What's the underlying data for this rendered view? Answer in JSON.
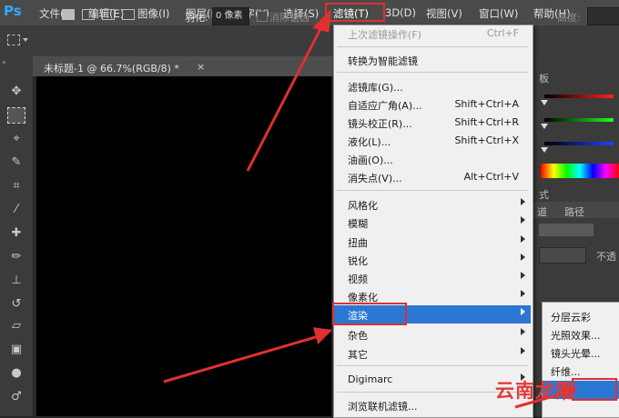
{
  "app": {
    "logo": "Ps"
  },
  "menubar": {
    "items": [
      "文件(F)",
      "编辑(E)",
      "图像(I)",
      "图层(L)",
      "文字(Y)",
      "选择(S)",
      "滤镜(T)",
      "3D(D)",
      "视图(V)",
      "窗口(W)",
      "帮助(H)"
    ],
    "active_index": 6
  },
  "options": {
    "feather_label": "羽化:",
    "feather_value": "0 像素",
    "antialias_label": "消除锯齿",
    "height_label": "高度:"
  },
  "document": {
    "tab_title": "未标题-1 @ 66.7%(RGB/8) *",
    "close": "×"
  },
  "filter_menu": {
    "items": [
      {
        "label": "上次滤镜操作(F)",
        "shortcut": "Ctrl+F",
        "disabled": true
      },
      {
        "label": "转换为智能滤镜"
      },
      {
        "label": "滤镜库(G)..."
      },
      {
        "label": "自适应广角(A)...",
        "shortcut": "Shift+Ctrl+A"
      },
      {
        "label": "镜头校正(R)...",
        "shortcut": "Shift+Ctrl+R"
      },
      {
        "label": "液化(L)...",
        "shortcut": "Shift+Ctrl+X"
      },
      {
        "label": "油画(O)..."
      },
      {
        "label": "消失点(V)...",
        "shortcut": "Alt+Ctrl+V"
      },
      {
        "label": "风格化",
        "submenu": true
      },
      {
        "label": "模糊",
        "submenu": true
      },
      {
        "label": "扭曲",
        "submenu": true
      },
      {
        "label": "锐化",
        "submenu": true
      },
      {
        "label": "视频",
        "submenu": true
      },
      {
        "label": "像素化",
        "submenu": true
      },
      {
        "label": "渲染",
        "submenu": true,
        "highlighted": true
      },
      {
        "label": "杂色",
        "submenu": true
      },
      {
        "label": "其它",
        "submenu": true
      },
      {
        "label": "Digimarc",
        "submenu": true
      },
      {
        "label": "浏览联机滤镜..."
      }
    ]
  },
  "render_submenu": {
    "items": [
      {
        "label": "分层云彩"
      },
      {
        "label": "光照效果..."
      },
      {
        "label": "镜头光晕..."
      },
      {
        "label": "纤维..."
      },
      {
        "label": "",
        "highlighted": true
      }
    ]
  },
  "right_panel": {
    "tabs_top": [
      "板"
    ],
    "tabs_mid": [
      "式"
    ],
    "tabs_layers": [
      "道",
      "路径"
    ],
    "opacity_label": "不透"
  },
  "watermark": "云南龙网",
  "colors": {
    "highlight": "#2a78d4",
    "annotation_red": "#e03030",
    "ps_blue": "#31a8ff"
  }
}
